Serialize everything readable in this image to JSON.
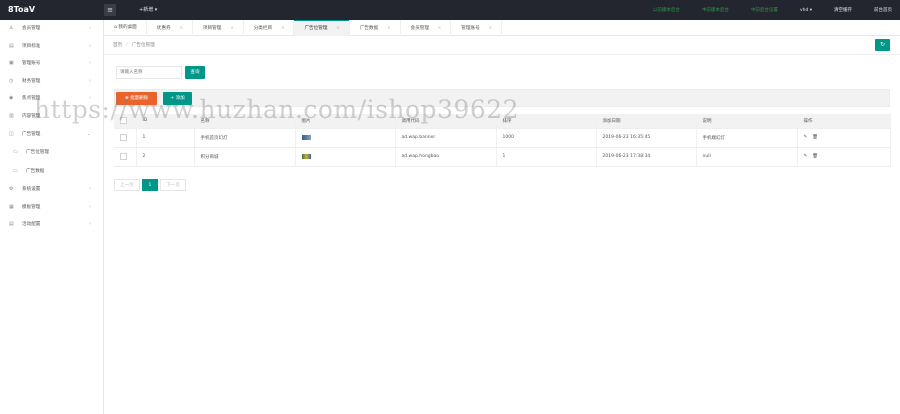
{
  "app": {
    "logo": "8ToaV"
  },
  "header": {
    "toggle_icon": "hamburger-icon",
    "new_label": "+新增 ▾",
    "links": [
      {
        "label": "以前版本后台",
        "color": "#2e9a4a"
      },
      {
        "label": "中前版本后台",
        "color": "#2e9a4a"
      },
      {
        "label": "中前后台设置",
        "color": "#2e9a4a"
      },
      {
        "label": "vhd ▾",
        "color": "#e8e8e8"
      },
      {
        "label": "清空缓存",
        "color": "#e8e8e8"
      },
      {
        "label": "前台首页",
        "color": "#e8e8e8"
      }
    ]
  },
  "sidebar": {
    "items": [
      {
        "icon": "user-icon",
        "glyph": "♙",
        "label": "会员管理",
        "arrow": "‹"
      },
      {
        "icon": "project-icon",
        "glyph": "▤",
        "label": "项目标准",
        "arrow": "‹"
      },
      {
        "icon": "account-icon",
        "glyph": "▣",
        "label": "管理账号",
        "arrow": "‹"
      },
      {
        "icon": "finance-icon",
        "glyph": "◷",
        "label": "财务管理",
        "arrow": "‹"
      },
      {
        "icon": "task-icon",
        "glyph": "◉",
        "label": "焦点管理",
        "arrow": "‹"
      },
      {
        "icon": "article-icon",
        "glyph": "▥",
        "label": "内容管理",
        "arrow": "‹"
      },
      {
        "icon": "ad-icon",
        "glyph": "◫",
        "label": "广告管理",
        "arrow": "‹",
        "open": true
      },
      {
        "icon": "ad-position-icon",
        "glyph": "▭",
        "label": "广告位管理",
        "sub": true
      },
      {
        "icon": "ad-data-icon",
        "glyph": "▭",
        "label": "广告数据",
        "sub": true
      },
      {
        "icon": "settings-icon",
        "glyph": "⚙",
        "label": "系统设置",
        "arrow": "‹"
      },
      {
        "icon": "template-icon",
        "glyph": "▦",
        "label": "模板管理",
        "arrow": "‹"
      },
      {
        "icon": "config-icon",
        "glyph": "▤",
        "label": "活动配置",
        "arrow": "‹"
      }
    ]
  },
  "tabs": [
    {
      "label": "我的桌面",
      "icon": "home-icon",
      "glyph": "⌂",
      "closable": false,
      "active": false
    },
    {
      "label": "优惠券",
      "closable": true,
      "active": false
    },
    {
      "label": "项目管理",
      "closable": true,
      "active": false
    },
    {
      "label": "分类栏目",
      "closable": true,
      "active": false
    },
    {
      "label": "广告位管理",
      "closable": true,
      "active": true
    },
    {
      "label": "广告数据",
      "closable": true,
      "active": false
    },
    {
      "label": "会员管理",
      "closable": true,
      "active": false
    },
    {
      "label": "管理账号",
      "closable": true,
      "active": false
    }
  ],
  "breadcrumb": {
    "home": "首页",
    "sep": "/",
    "current": "广告位管理"
  },
  "refresh_icon": "refresh-icon",
  "search": {
    "placeholder": "请输入名称",
    "button": "查询"
  },
  "toolbar": {
    "delete_label": "⊗ 批量删除",
    "add_label": "+ 添加"
  },
  "table": {
    "columns": [
      "",
      "ID",
      "名称",
      "图片",
      "调用代码",
      "排序",
      "添加日期",
      "说明",
      "操作"
    ],
    "rows": [
      {
        "id": "1",
        "name": "手机首页幻灯",
        "thumb": "a",
        "code": "ad.wap.banner",
        "sort": "1000",
        "date": "2019-06-23 16:35:45",
        "desc": "手机端幻灯",
        "edit_icon": "edit-icon",
        "delete_icon": "trash-icon"
      },
      {
        "id": "2",
        "name": "积分商城",
        "thumb": "b",
        "code": "ad.wap.hongbao",
        "sort": "1",
        "date": "2019-06-23 17:38:34",
        "desc": "null",
        "edit_icon": "edit-icon",
        "delete_icon": "trash-icon"
      }
    ]
  },
  "pager": {
    "prev": "上一页",
    "current": "1",
    "next": "下一页"
  },
  "watermark": "https://www.huzhan.com/ishop39622"
}
